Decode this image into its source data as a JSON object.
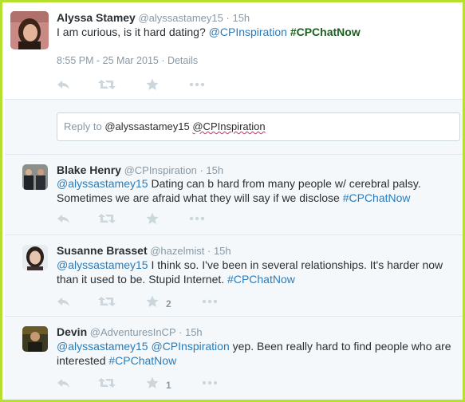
{
  "main_tweet": {
    "name": "Alyssa Stamey",
    "handle": "@alyssastamey15",
    "dot": "·",
    "time": "15h",
    "text_plain": "I am curious, is it hard dating?",
    "mention": "@CPInspiration",
    "hashtag": "#CPChatNow",
    "timestamp": "8:55 PM - 25 Mar 2015 · Details"
  },
  "reply_box": {
    "prefix": "Reply to",
    "mention1": "@alyssastamey15",
    "mention2": "@CPInspiration"
  },
  "replies": [
    {
      "name": "Blake Henry",
      "handle": "@CPInspiration",
      "dot": "·",
      "time": "15h",
      "mention": "@alyssastamey15",
      "text1": "Dating can b hard from many people w/ cerebral palsy.",
      "text2": "Sometimes we are afraid what they will say if we disclose",
      "hashtag": "#CPChatNow",
      "favorite_count": ""
    },
    {
      "name": "Susanne Brasset",
      "handle": "@hazelmist",
      "dot": "·",
      "time": "15h",
      "mention": "@alyssastamey15",
      "text1": "I think so. I've been in several relationships. It's harder now",
      "text2": "than it used to be. Stupid Internet.",
      "hashtag": "#CPChatNow",
      "favorite_count": "2"
    },
    {
      "name": "Devin",
      "handle": "@AdventuresInCP",
      "dot": "·",
      "time": "15h",
      "mention": "@alyssastamey15",
      "mention2": "@CPInspiration",
      "text1": "yep. Been really hard to find people who are",
      "text2": "interested",
      "hashtag": "#CPChatNow",
      "favorite_count": "1"
    }
  ],
  "icons": [
    "reply-icon",
    "retweet-icon",
    "favorite-icon",
    "more-icon"
  ],
  "colors": {
    "frame": "#b6e02e",
    "link": "#2b7bb9",
    "muted": "#8899a6",
    "hashtag_main": "#1b5e20"
  }
}
